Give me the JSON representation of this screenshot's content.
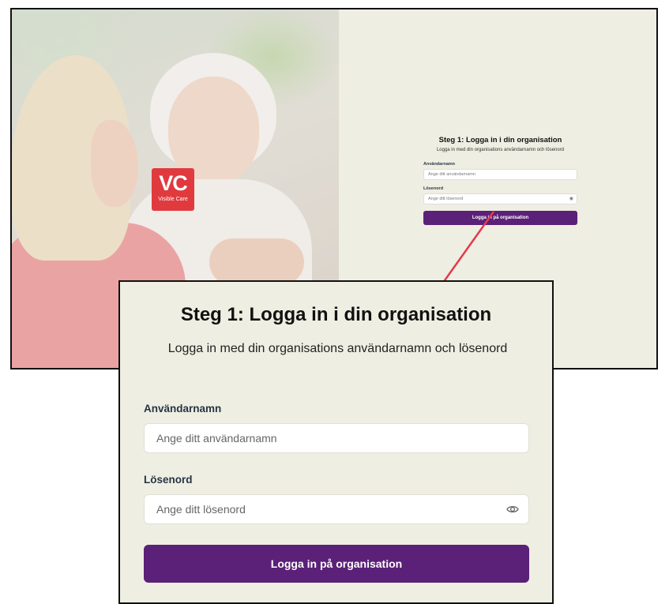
{
  "logo": {
    "initials": "VC",
    "name": "Visible Care",
    "color": "#e03a3e"
  },
  "login": {
    "title": "Steg 1: Logga in i din organisation",
    "subtitle": "Logga in med din organisations användarnamn och lösenord",
    "username_label": "Användarnamn",
    "username_placeholder": "Ange ditt användarnamn",
    "password_label": "Lösenord",
    "password_placeholder": "Ange ditt lösenord",
    "password_toggle_icon": "eye-icon",
    "submit_label": "Logga in på organisation"
  },
  "colors": {
    "accent": "#5b2078",
    "background": "#efeee2",
    "arrow": "#e23b4c"
  }
}
